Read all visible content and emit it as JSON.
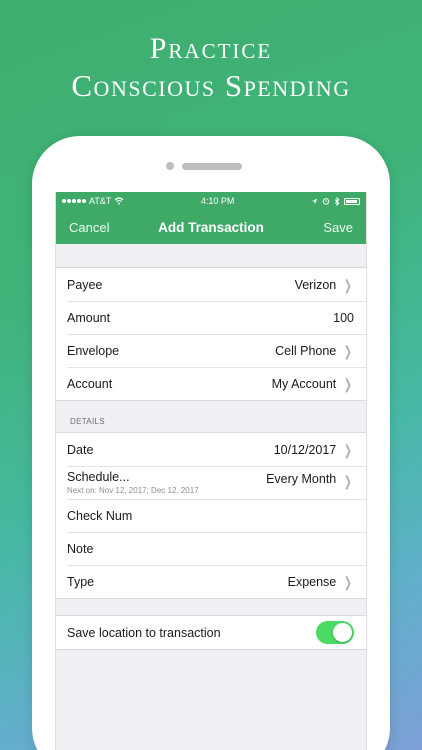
{
  "headline": {
    "line1": "Practice",
    "line2": "Conscious Spending"
  },
  "status_bar": {
    "carrier": "AT&T",
    "time": "4:10 PM"
  },
  "nav": {
    "cancel": "Cancel",
    "title": "Add Transaction",
    "save": "Save"
  },
  "main_rows": [
    {
      "label": "Payee",
      "value": "Verizon",
      "chevron": true
    },
    {
      "label": "Amount",
      "value": "100",
      "chevron": false
    },
    {
      "label": "Envelope",
      "value": "Cell Phone",
      "chevron": true
    },
    {
      "label": "Account",
      "value": "My Account",
      "chevron": true
    }
  ],
  "details": {
    "section_title": "DETAILS",
    "date": {
      "label": "Date",
      "value": "10/12/2017"
    },
    "schedule": {
      "label": "Schedule...",
      "value": "Every Month",
      "next": "Next on: Nov 12, 2017; Dec 12, 2017"
    },
    "check_num": {
      "label": "Check Num",
      "value": ""
    },
    "note": {
      "label": "Note",
      "value": ""
    },
    "type": {
      "label": "Type",
      "value": "Expense"
    }
  },
  "location": {
    "label": "Save location to transaction",
    "enabled": true
  },
  "colors": {
    "accent": "#3faa68",
    "toggle_on": "#4cd964"
  }
}
